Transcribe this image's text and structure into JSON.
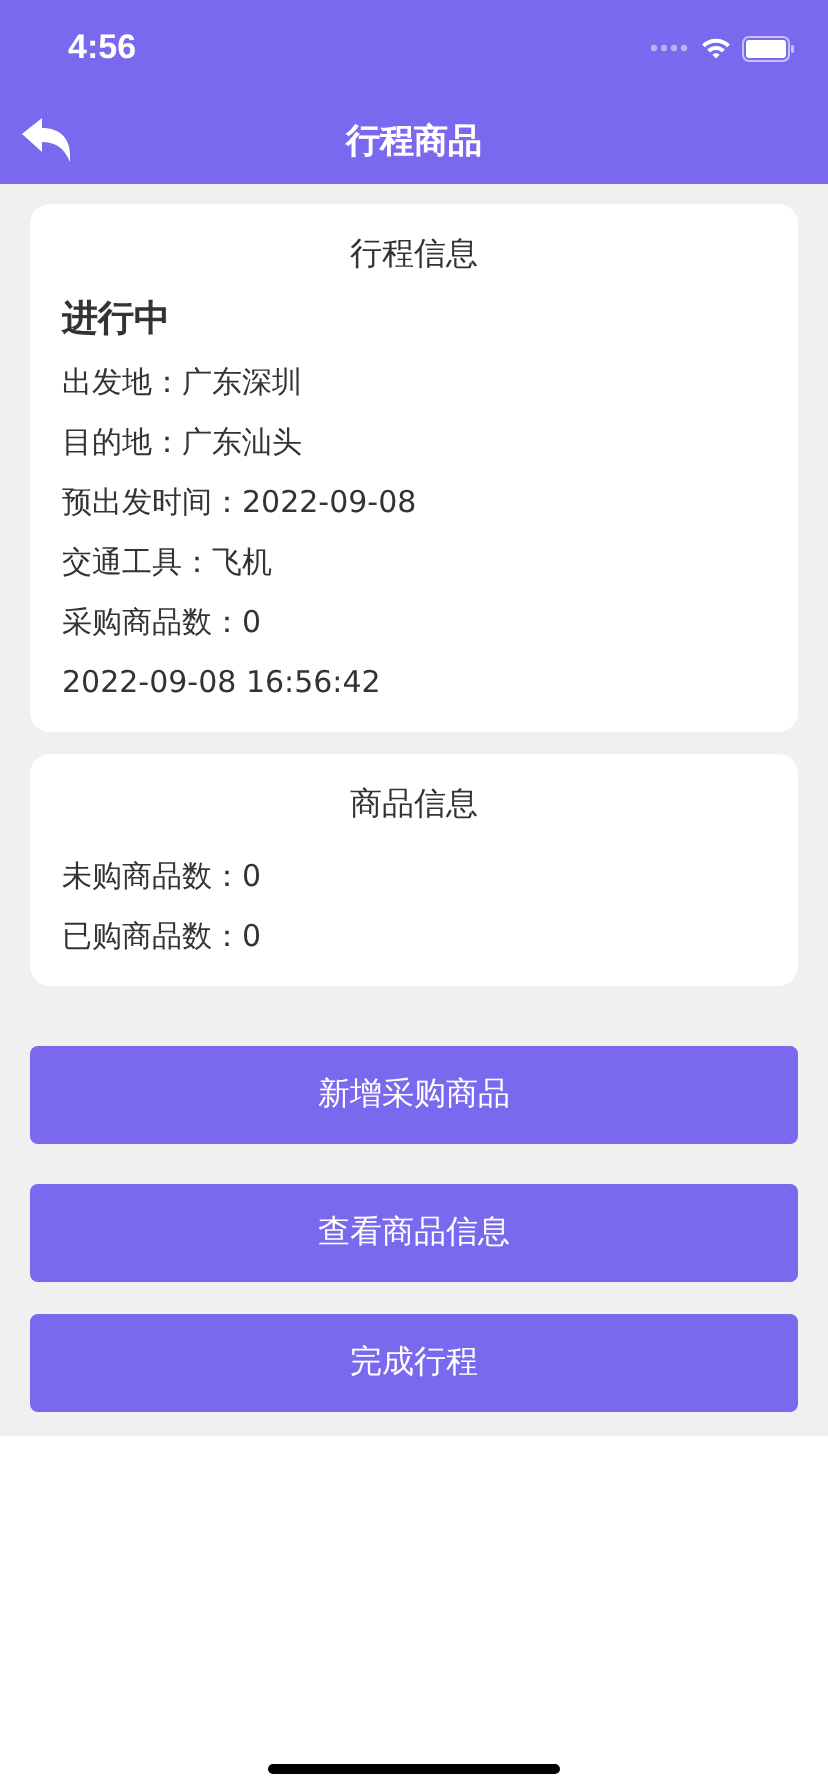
{
  "status_bar": {
    "time": "4:56"
  },
  "nav_bar": {
    "title": "行程商品"
  },
  "trip_card": {
    "title": "行程信息",
    "status": "进行中",
    "lines": [
      "出发地：广东深圳",
      "目的地：广东汕头",
      "预出发时间：2022-09-08",
      "交通工具：飞机",
      "采购商品数：0",
      "2022-09-08 16:56:42"
    ]
  },
  "goods_card": {
    "title": "商品信息",
    "lines": [
      "未购商品数：0",
      "已购商品数：0"
    ]
  },
  "buttons": [
    "新增采购商品",
    "查看商品信息",
    "完成行程"
  ]
}
